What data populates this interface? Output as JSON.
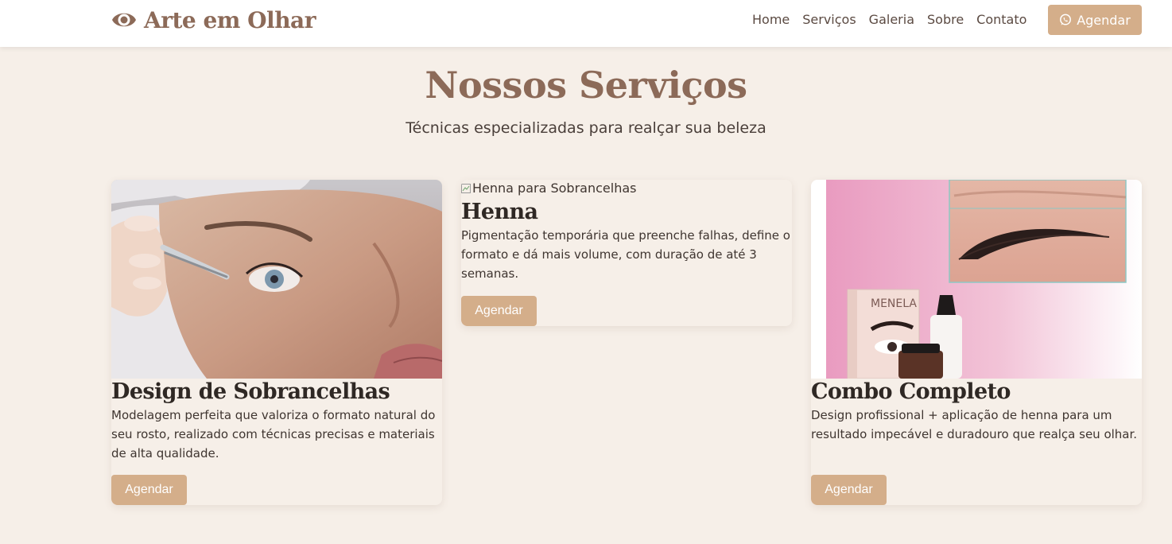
{
  "header": {
    "brand_name": "Arte em Olhar",
    "brand_icon": "eye-icon",
    "nav": [
      {
        "label": "Home"
      },
      {
        "label": "Serviços"
      },
      {
        "label": "Galeria"
      },
      {
        "label": "Sobre"
      },
      {
        "label": "Contato"
      }
    ],
    "cta_label": "Agendar",
    "cta_icon": "whatsapp-icon"
  },
  "services": {
    "title": "Nossos Serviços",
    "subtitle": "Técnicas especializadas para realçar sua beleza",
    "cards": [
      {
        "image_alt": "",
        "title": "Design de Sobrancelhas",
        "description": "Modelagem perfeita que valoriza o formato natural do seu rosto, realizado com técnicas precisas e materiais de alta qualidade.",
        "button": "Agendar"
      },
      {
        "image_alt": "Henna para Sobrancelhas",
        "title": "Henna",
        "description": "Pigmentação temporária que preenche falhas, define o formato e dá mais volume, com duração de até 3 semanas.",
        "button": "Agendar"
      },
      {
        "image_alt": "",
        "title": "Combo Completo",
        "description": "Design profissional + aplicação de henna para um resultado impecável e duradouro que realça seu olhar.",
        "button": "Agendar",
        "product_label": "MENELA"
      }
    ]
  },
  "colors": {
    "accent": "#d4ae8a",
    "brand": "#8c6a58",
    "background": "#f6efe8"
  }
}
